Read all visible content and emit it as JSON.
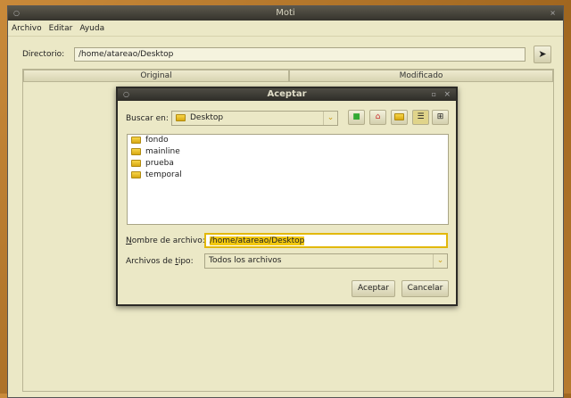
{
  "window": {
    "title": "Moti"
  },
  "menu": [
    "Archivo",
    "Editar",
    "Ayuda"
  ],
  "directory": {
    "label": "Directorio:",
    "value": "/home/atareao/Desktop"
  },
  "table": {
    "columns": [
      "Original",
      "Modificado"
    ]
  },
  "dialog": {
    "title": "Aceptar",
    "look_in_label": "Buscar en:",
    "look_in_value": "Desktop",
    "files": [
      "fondo",
      "mainline",
      "prueba",
      "temporal"
    ],
    "filename_label_first": "N",
    "filename_label_rest": "ombre de archivo:",
    "filename_value": "/home/atareao/Desktop",
    "filetype_label_pre": "Archivos de ",
    "filetype_label_u": "t",
    "filetype_label_post": "ipo:",
    "filetype_value": "Todos los archivos",
    "accept": "Aceptar",
    "cancel": "Cancelar"
  }
}
